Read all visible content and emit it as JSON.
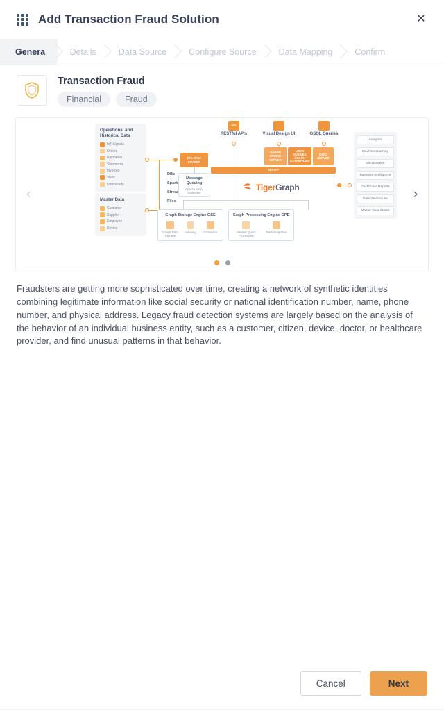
{
  "header": {
    "title": "Add Transaction Fraud Solution",
    "grid_icon": "apps-grid-icon",
    "close_label": "✕"
  },
  "stepper": {
    "steps": [
      {
        "label": "General",
        "active": true
      },
      {
        "label": "Details",
        "active": false
      },
      {
        "label": "Data Source",
        "active": false
      },
      {
        "label": "Configure Source",
        "active": false
      },
      {
        "label": "Data Mapping",
        "active": false
      },
      {
        "label": "Confirm",
        "active": false
      }
    ]
  },
  "solution": {
    "icon": "shield-icon",
    "name": "Transaction Fraud",
    "tags": [
      "Financial",
      "Fraud"
    ]
  },
  "carousel": {
    "prev_label": "‹",
    "next_label": "›",
    "dots": [
      {
        "active": true
      },
      {
        "active": false
      }
    ]
  },
  "diagram": {
    "left_panels": [
      {
        "title": "Operational and Historical Data",
        "items": [
          "IoT Signals",
          "Orders",
          "Payments",
          "Shipments",
          "Invoices",
          "Visits",
          "Downloads"
        ]
      },
      {
        "title": "Master Data",
        "items": [
          "Customer",
          "Supplier",
          "Employee",
          "Device"
        ]
      }
    ],
    "connectors": [
      "DBs",
      "Spark",
      "Stream",
      "Files"
    ],
    "etl_box": "ETL DATA LOADER",
    "message_queue": {
      "title": "Message Queuing",
      "subtitle": "Apache Kafka zookeeper"
    },
    "top_caps": [
      {
        "label": "RESTful APIs",
        "icon": "code-icon"
      },
      {
        "label": "Visual Design UI",
        "icon": "design-icon"
      },
      {
        "label": "GSQL Queries",
        "icon": "query-icon"
      }
    ],
    "servers": [
      "GRAPH STUDIO SERVER",
      "USER QUERIES GRAPH ALGORITHMS",
      "GSQL SERVER"
    ],
    "rest_bar": "RESTPP",
    "logo": {
      "part1": "Tiger",
      "part2": "Graph"
    },
    "engines": [
      {
        "title": "Graph Storage Engine GSE",
        "items": [
          "Graph Data Storage",
          "Indexing",
          "ID Service"
        ]
      },
      {
        "title": "Graph Processing Engine GPE",
        "items": [
          "Parallel Query Processing",
          "Data Snapshot"
        ]
      }
    ],
    "right_panel": [
      "Analytics",
      "Machine Learning",
      "Visualization",
      "Business Intelligence",
      "Dashboard Reports",
      "Data Warehouse",
      "Master Data Stores"
    ]
  },
  "description": "Fraudsters are getting more sophisticated over time, creating a network of synthetic identities combining legitimate information like social security or national identification number, name, phone number, and physical address. Legacy fraud detection systems are largely based on the analysis of the behavior of an individual business entity, such as a customer, citizen, device, doctor, or healthcare provider, and find unusual patterns in that behavior.",
  "footer": {
    "cancel_label": "Cancel",
    "next_label": "Next"
  },
  "colors": {
    "accent_orange": "#eda14f",
    "brand_orange": "#f0782d",
    "title_navy": "#36405a"
  }
}
